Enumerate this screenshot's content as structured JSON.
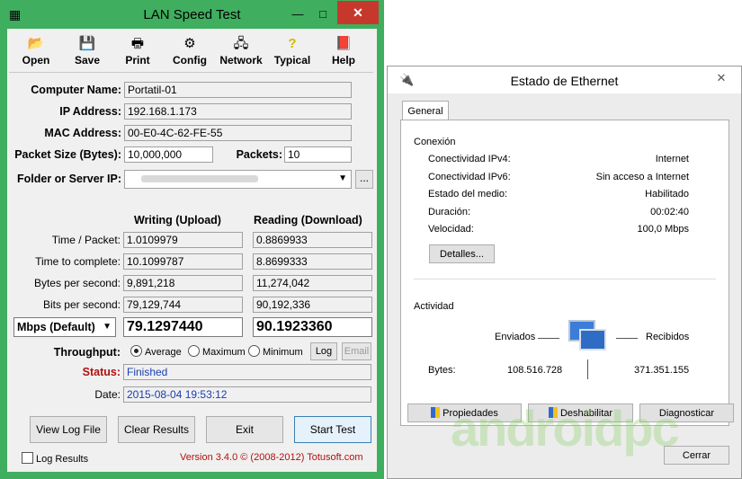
{
  "lan": {
    "title": "LAN Speed Test",
    "window_controls": {
      "minimize": "—",
      "maximize": "□",
      "close": "✕"
    },
    "toolbar": [
      {
        "label": "Open",
        "icon": "open-folder-icon"
      },
      {
        "label": "Save",
        "icon": "floppy-icon"
      },
      {
        "label": "Print",
        "icon": "printer-icon"
      },
      {
        "label": "Config",
        "icon": "config-icon"
      },
      {
        "label": "Network",
        "icon": "network-icon"
      },
      {
        "label": "Typical",
        "icon": "question-icon"
      },
      {
        "label": "Help",
        "icon": "help-book-icon"
      }
    ],
    "computer_name_label": "Computer Name:",
    "computer_name": "Portatil-01",
    "ip_label": "IP Address:",
    "ip": "192.168.1.173",
    "mac_label": "MAC Address:",
    "mac": "00-E0-4C-62-FE-55",
    "packet_size_label": "Packet Size (Bytes):",
    "packet_size": "10,000,000",
    "packets_label": "Packets:",
    "packets": "10",
    "folder_label": "Folder or Server IP:",
    "folder_value": "",
    "browse_label": "...",
    "col_write": "Writing (Upload)",
    "col_read": "Reading (Download)",
    "rows": [
      {
        "label": "Time / Packet:",
        "write": "1.0109979",
        "read": "0.8869933"
      },
      {
        "label": "Time to complete:",
        "write": "10.1099787",
        "read": "8.8699333"
      },
      {
        "label": "Bytes per second:",
        "write": "9,891,218",
        "read": "11,274,042"
      },
      {
        "label": "Bits per second:",
        "write": "79,129,744",
        "read": "90,192,336"
      }
    ],
    "unit_select": "Mbps (Default)",
    "write_mbps": "79.1297440",
    "read_mbps": "90.1923360",
    "throughput_label": "Throughput:",
    "radio": {
      "average": "Average",
      "maximum": "Maximum",
      "minimum": "Minimum",
      "selected": "average"
    },
    "log_button": "Log",
    "email_button": "Email",
    "status_label": "Status:",
    "status": "Finished",
    "date_label": "Date:",
    "date": "2015-08-04 19:53:12",
    "buttons": {
      "view_log": "View Log File",
      "clear": "Clear Results",
      "exit": "Exit",
      "start": "Start Test"
    },
    "log_results": "Log Results",
    "version": "Version 3.4.0  © (2008-2012) Totusoft.com",
    "colors": {
      "frame": "#3fae5e",
      "status_red": "#b01010",
      "version_red": "#b01010"
    }
  },
  "eth": {
    "title": "Estado de Ethernet",
    "tab": "General",
    "conexion_header": "Conexión",
    "conexion": [
      {
        "label": "Conectividad IPv4:",
        "value": "Internet"
      },
      {
        "label": "Conectividad IPv6:",
        "value": "Sin acceso a Internet"
      },
      {
        "label": "Estado del medio:",
        "value": "Habilitado"
      },
      {
        "label": "Duración:",
        "value": "00:02:40"
      },
      {
        "label": "Velocidad:",
        "value": "100,0 Mbps"
      }
    ],
    "details_button": "Detalles...",
    "actividad_header": "Actividad",
    "sent_label": "Enviados",
    "received_label": "Recibidos",
    "bytes_label": "Bytes:",
    "bytes_sent": "108.516.728",
    "bytes_received": "371.351.155",
    "properties_button": "Propiedades",
    "disable_button": "Deshabilitar",
    "diagnose_button": "Diagnosticar",
    "close_button": "Cerrar",
    "close_icon": "✕"
  },
  "watermark": "androidpc"
}
